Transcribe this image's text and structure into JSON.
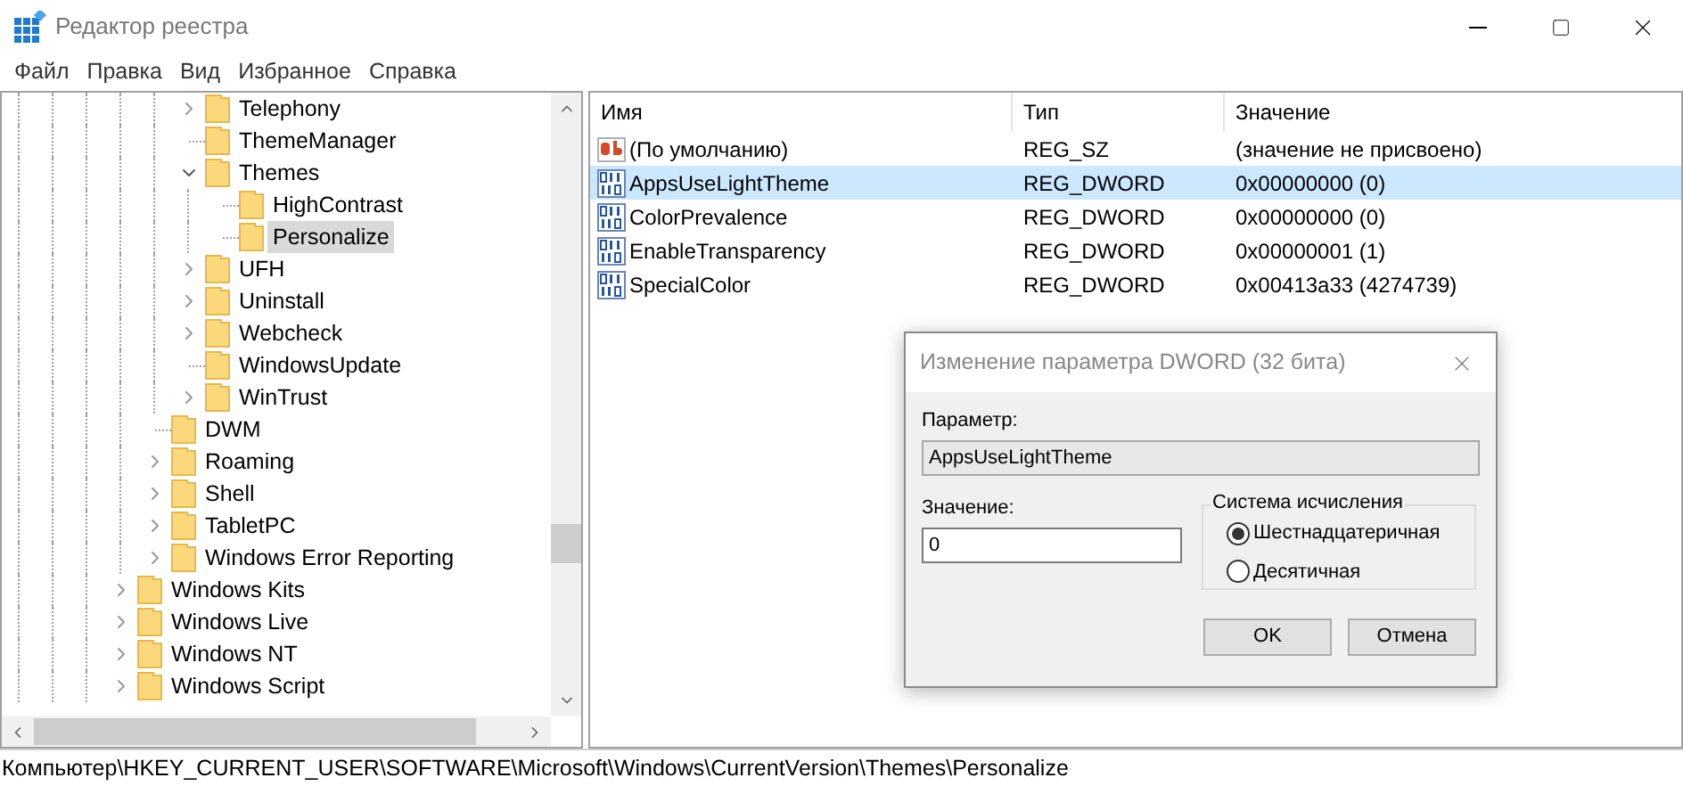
{
  "window": {
    "title": "Редактор реестра"
  },
  "menu": [
    "Файл",
    "Правка",
    "Вид",
    "Избранное",
    "Справка"
  ],
  "tree": {
    "items": [
      {
        "children": [
          {
            "children": [
              {
                "label": "Telephony",
                "expanded": false,
                "selected": false
              },
              {
                "label": "ThemeManager",
                "selected": false
              },
              {
                "label": "Themes",
                "expanded": true,
                "selected": false,
                "children": [
                  {
                    "label": "HighContrast",
                    "selected": false
                  },
                  {
                    "label": "Personalize",
                    "selected": true
                  }
                ]
              },
              {
                "label": "UFH",
                "expanded": false,
                "selected": false
              },
              {
                "label": "Uninstall",
                "expanded": false,
                "selected": false
              },
              {
                "label": "Webcheck",
                "expanded": false,
                "selected": false
              },
              {
                "label": "WindowsUpdate",
                "selected": false
              },
              {
                "label": "WinTrust",
                "expanded": false,
                "selected": false
              }
            ]
          },
          {
            "label": "DWM",
            "selected": false
          },
          {
            "label": "Roaming",
            "expanded": false,
            "selected": false
          },
          {
            "label": "Shell",
            "expanded": false,
            "selected": false
          },
          {
            "label": "TabletPC",
            "expanded": false,
            "selected": false
          },
          {
            "label": "Windows Error Reporting",
            "expanded": false,
            "selected": false
          }
        ]
      },
      {
        "label": "Windows Kits",
        "expanded": false,
        "selected": false
      },
      {
        "label": "Windows Live",
        "expanded": false,
        "selected": false
      },
      {
        "label": "Windows NT",
        "expanded": false,
        "selected": false
      },
      {
        "label": "Windows Script",
        "expanded": false,
        "selected": false
      }
    ]
  },
  "values": {
    "columns": [
      "Имя",
      "Тип",
      "Значение"
    ],
    "rows": [
      {
        "kind": "string",
        "name": "(По умолчанию)",
        "type": "REG_SZ",
        "data": "(значение не присвоено)",
        "selected": false
      },
      {
        "kind": "binary",
        "name": "AppsUseLightTheme",
        "type": "REG_DWORD",
        "data": "0x00000000 (0)",
        "selected": true
      },
      {
        "kind": "binary",
        "name": "ColorPrevalence",
        "type": "REG_DWORD",
        "data": "0x00000000 (0)",
        "selected": false
      },
      {
        "kind": "binary",
        "name": "EnableTransparency",
        "type": "REG_DWORD",
        "data": "0x00000001 (1)",
        "selected": false
      },
      {
        "kind": "binary",
        "name": "SpecialColor",
        "type": "REG_DWORD",
        "data": "0x00413a33 (4274739)",
        "selected": false
      }
    ]
  },
  "dialog": {
    "title": "Изменение параметра DWORD (32 бита)",
    "name_label": "Параметр:",
    "name_value": "AppsUseLightTheme",
    "value_label": "Значение:",
    "value": "0",
    "base_title": "Система исчисления",
    "bases": [
      {
        "label": "Шестнадцатеричная",
        "selected": true
      },
      {
        "label": "Десятичная",
        "selected": false
      }
    ],
    "buttons": [
      "OK",
      "Отмена"
    ]
  },
  "status_bar": "Компьютер\\HKEY_CURRENT_USER\\SOFTWARE\\Microsoft\\Windows\\CurrentVersion\\Themes\\Personalize"
}
